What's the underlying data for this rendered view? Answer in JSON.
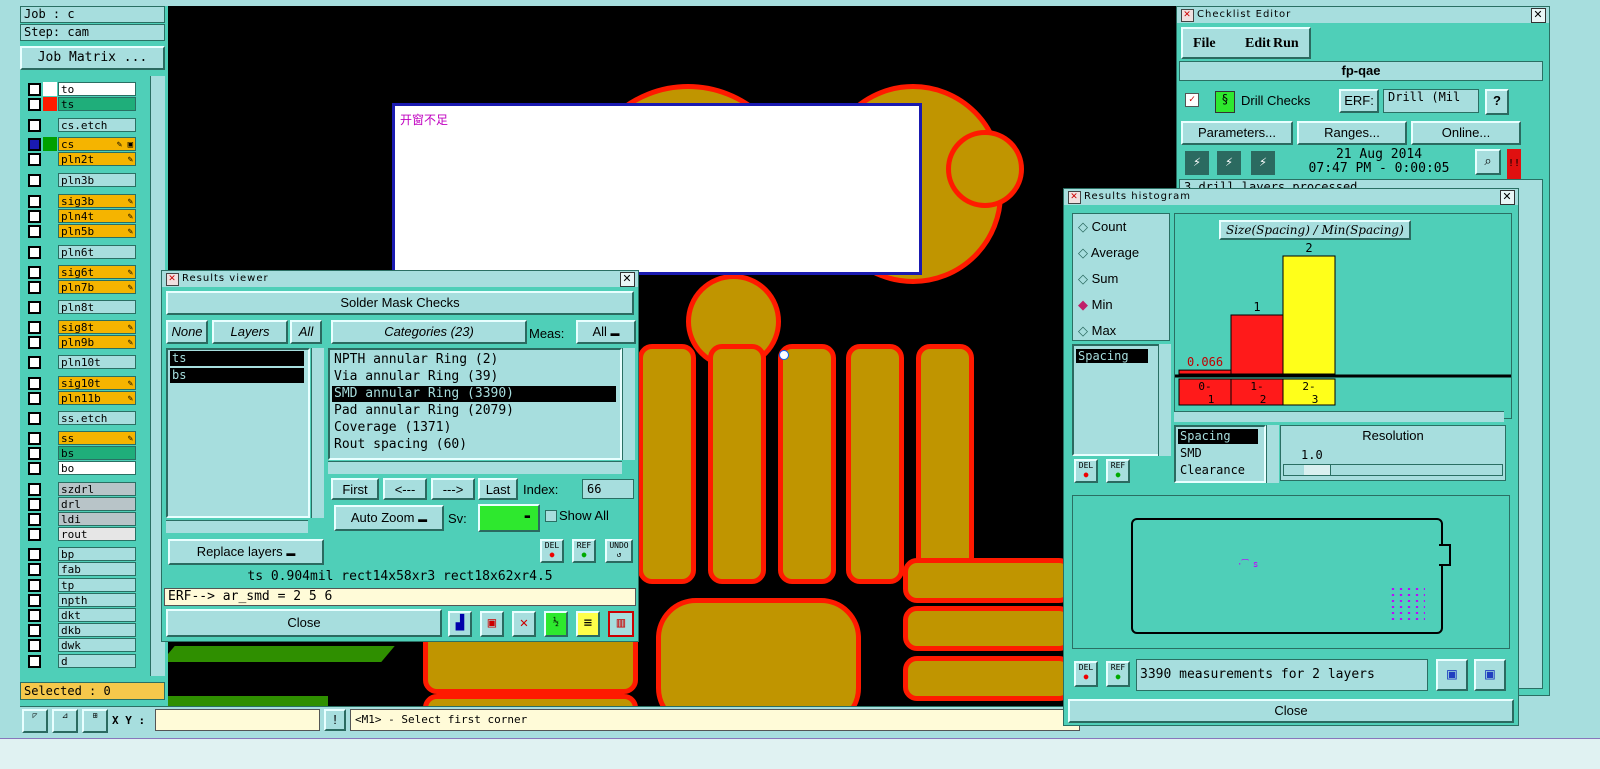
{
  "job_panel": {
    "job": "Job : c",
    "step": "Step: cam",
    "matrix_button": "Job Matrix ..."
  },
  "layers": [
    {
      "name": "to",
      "color": "#ffffff",
      "swatch": "#ffffff",
      "icon": ""
    },
    {
      "name": "ts",
      "color": "#1fae7a",
      "swatch": "#ff1a00",
      "icon": ""
    },
    {
      "name": "cs.etch",
      "color": "#a7dede",
      "swatch": "",
      "icon": ""
    },
    {
      "name": "cs",
      "color": "#f5b400",
      "swatch": "#00a000",
      "icon": "✎ ▣"
    },
    {
      "name": "pln2t",
      "color": "#f5b400",
      "swatch": "",
      "icon": "✎"
    },
    {
      "name": "pln3b",
      "color": "#a7dede",
      "swatch": "",
      "icon": ""
    },
    {
      "name": "sig3b",
      "color": "#f5b400",
      "swatch": "",
      "icon": "✎"
    },
    {
      "name": "pln4t",
      "color": "#f5b400",
      "swatch": "",
      "icon": "✎"
    },
    {
      "name": "pln5b",
      "color": "#f5b400",
      "swatch": "",
      "icon": "✎"
    },
    {
      "name": "pln6t",
      "color": "#a7dede",
      "swatch": "",
      "icon": ""
    },
    {
      "name": "sig6t",
      "color": "#f5b400",
      "swatch": "",
      "icon": "✎"
    },
    {
      "name": "pln7b",
      "color": "#f5b400",
      "swatch": "",
      "icon": "✎"
    },
    {
      "name": "pln8t",
      "color": "#a7dede",
      "swatch": "",
      "icon": ""
    },
    {
      "name": "sig8t",
      "color": "#f5b400",
      "swatch": "",
      "icon": "✎"
    },
    {
      "name": "pln9b",
      "color": "#f5b400",
      "swatch": "",
      "icon": "✎"
    },
    {
      "name": "pln10t",
      "color": "#a7dede",
      "swatch": "",
      "icon": ""
    },
    {
      "name": "sig10t",
      "color": "#f5b400",
      "swatch": "",
      "icon": "✎"
    },
    {
      "name": "pln11b",
      "color": "#f5b400",
      "swatch": "",
      "icon": "✎"
    },
    {
      "name": "ss.etch",
      "color": "#a7dede",
      "swatch": "",
      "icon": ""
    },
    {
      "name": "ss",
      "color": "#f5b400",
      "swatch": "",
      "icon": "✎"
    },
    {
      "name": "bs",
      "color": "#1fae7a",
      "swatch": "",
      "icon": ""
    },
    {
      "name": "bo",
      "color": "#ffffff",
      "swatch": "",
      "icon": ""
    },
    {
      "name": "szdrl",
      "color": "#b8c4c8",
      "swatch": "",
      "icon": ""
    },
    {
      "name": "drl",
      "color": "#b8c4c8",
      "swatch": "",
      "icon": ""
    },
    {
      "name": "ldi",
      "color": "#b8c4c8",
      "swatch": "",
      "icon": ""
    },
    {
      "name": "rout",
      "color": "#e6e6e6",
      "swatch": "",
      "icon": ""
    },
    {
      "name": "bp",
      "color": "#a7dede",
      "swatch": "",
      "icon": ""
    },
    {
      "name": "fab",
      "color": "#a7dede",
      "swatch": "",
      "icon": ""
    },
    {
      "name": "tp",
      "color": "#a7dede",
      "swatch": "",
      "icon": ""
    },
    {
      "name": "npth",
      "color": "#a7dede",
      "swatch": "",
      "icon": ""
    },
    {
      "name": "dkt",
      "color": "#a7dede",
      "swatch": "",
      "icon": ""
    },
    {
      "name": "dkb",
      "color": "#a7dede",
      "swatch": "",
      "icon": ""
    },
    {
      "name": "dwk",
      "color": "#a7dede",
      "swatch": "",
      "icon": ""
    },
    {
      "name": "d",
      "color": "#a7dede",
      "swatch": "",
      "icon": ""
    }
  ],
  "selected": "Selected : 0",
  "bottom_bar": {
    "xy_label": "X Y :",
    "xy_value": "",
    "excl": "!",
    "status": "<M1> - Select first corner"
  },
  "popup": {
    "text": "开窗不足"
  },
  "results_viewer": {
    "title": "Results viewer",
    "header": "Solder Mask Checks",
    "none_btn": "None",
    "layers_btn": "Layers",
    "all_btn": "All",
    "layer_items": [
      "ts",
      "bs"
    ],
    "categories_btn": "Categories (23)",
    "meas_label": "Meas:",
    "meas_value": "All",
    "categories": [
      "NPTH annular Ring (2)",
      "Via annular Ring (39)",
      "SMD annular Ring (3390)",
      "Pad annular Ring (2079)",
      "Coverage (1371)",
      "Rout spacing (60)"
    ],
    "first": "First",
    "prev": "<---",
    "next": "--->",
    "last": "Last",
    "index_label": "Index:",
    "index_value": "66",
    "auto_zoom": "Auto Zoom",
    "sv_label": "Sv:",
    "show_all": "Show All",
    "replace_layers": "Replace layers",
    "del": "DEL",
    "ref": "REF",
    "undo": "UNDO",
    "info": "ts 0.904mil  rect14x58xr3  rect18x62xr4.5",
    "erf_line": "ERF--> ar_smd = 2 5 6",
    "close": "Close"
  },
  "checklist": {
    "title": "Checklist Editor",
    "menu": [
      "File",
      "Edit",
      "Run"
    ],
    "name": "fp-qae",
    "action": "Drill Checks",
    "erf_label": "ERF:",
    "erf_value": "Drill (Mil",
    "help": "?",
    "params": "Parameters...",
    "ranges": "Ranges...",
    "online": "Online...",
    "date": "21 Aug 2014",
    "time": "07:47 PM - 0:00:05",
    "log": "3 drill layers processed",
    "alert": "!!"
  },
  "histogram": {
    "title": "Results histogram",
    "modes": [
      "Count",
      "Average",
      "Sum",
      "Min",
      "Max"
    ],
    "selected_mode": "Min",
    "left_list": [
      "Spacing"
    ],
    "chart_title": "Size(Spacing) / Min(Spacing)",
    "lower_list": [
      "Spacing",
      "SMD",
      "Clearance"
    ],
    "resolution_label": "Resolution",
    "resolution_value": "1.0",
    "summary": "3390 measurements for 2 layers",
    "close": "Close",
    "del": "DEL",
    "ref": "REF"
  },
  "chart_data": {
    "type": "bar",
    "title": "Size(Spacing) / Min(Spacing)",
    "categories": [
      "0-1",
      "1-2",
      "2-3"
    ],
    "values": [
      0.066,
      1,
      2
    ],
    "data_labels": [
      "0.066",
      "1",
      "2"
    ],
    "colors": [
      "#ff1a1a",
      "#ff1a1a",
      "#ffff1a"
    ],
    "ylim": [
      0,
      2
    ]
  }
}
